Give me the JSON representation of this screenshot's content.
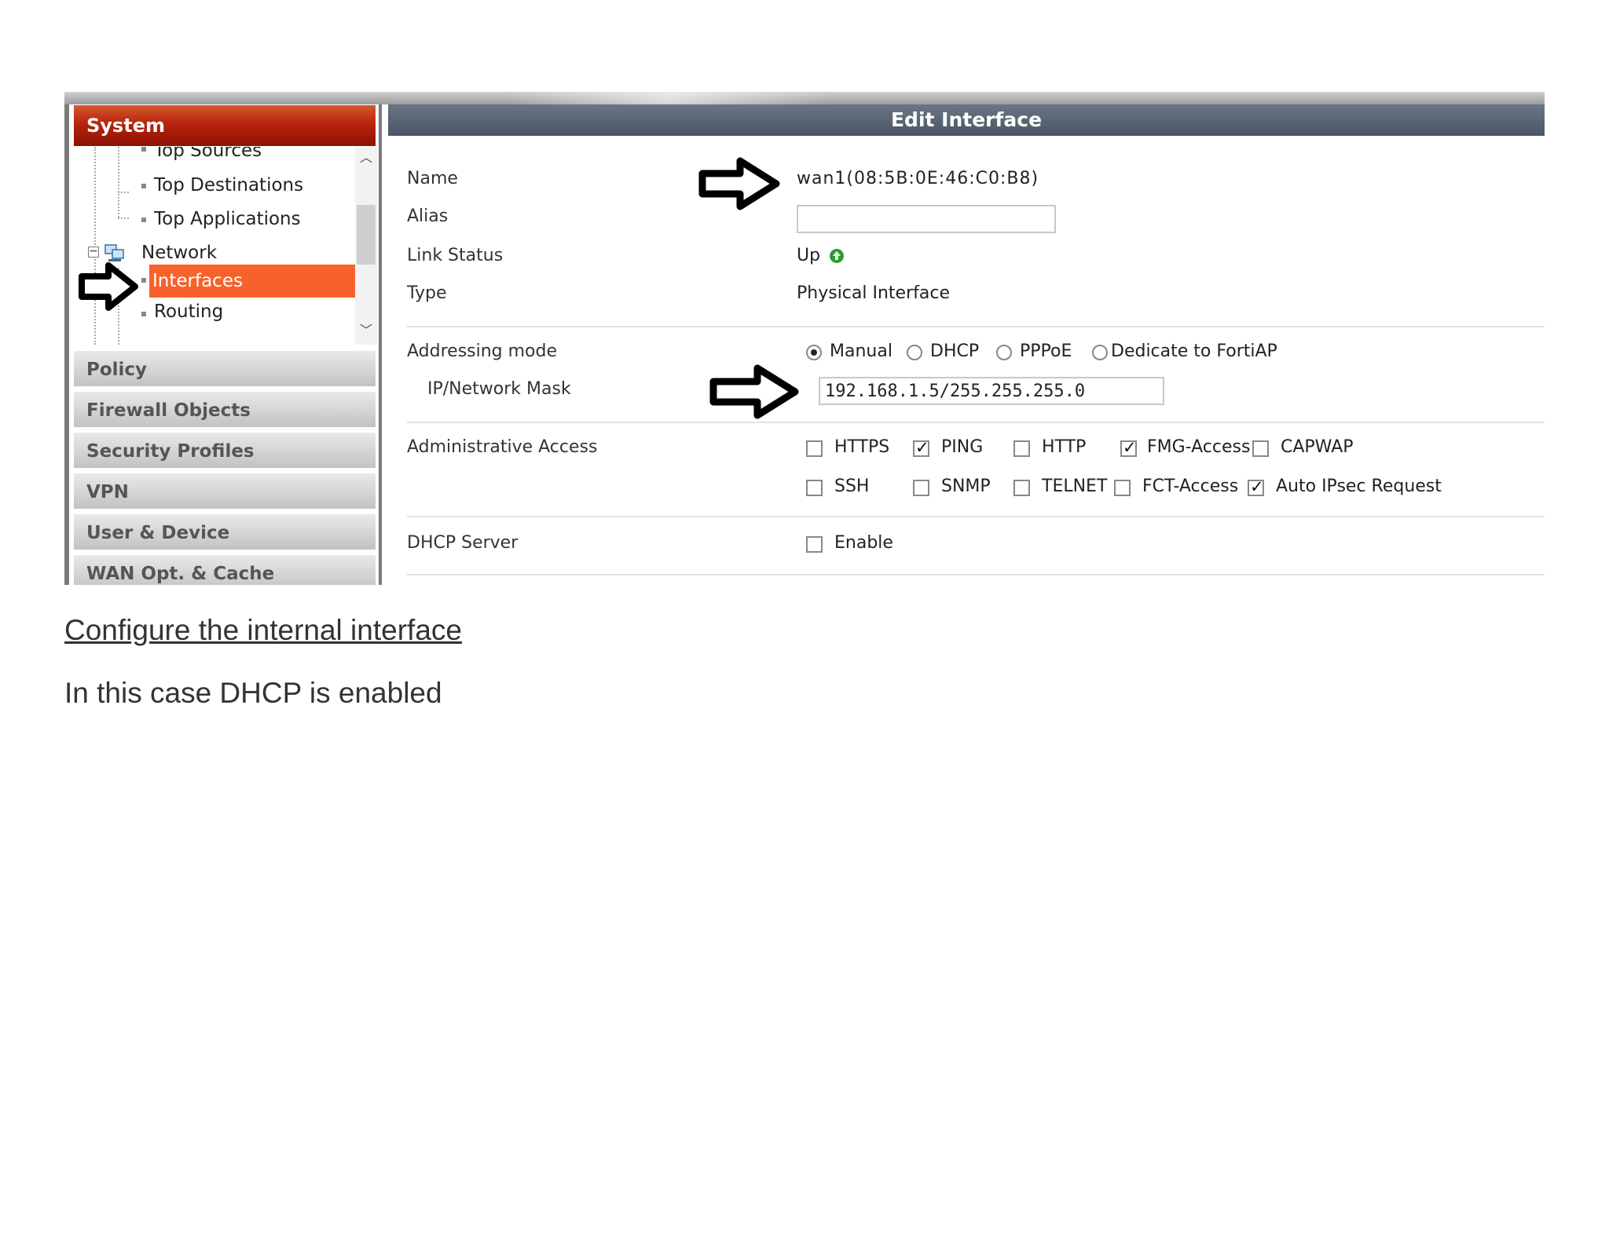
{
  "sidebar": {
    "header": "System",
    "tree": {
      "top_sources": "Top Sources",
      "top_destinations": "Top Destinations",
      "top_applications": "Top Applications",
      "network": "Network",
      "interfaces": "Interfaces",
      "routing": "Routing"
    },
    "sections": [
      "Policy",
      "Firewall Objects",
      "Security Profiles",
      "VPN",
      "User & Device",
      "WAN Opt. & Cache"
    ]
  },
  "panel": {
    "title": "Edit Interface",
    "name_label": "Name",
    "name_value": "wan1(08:5B:0E:46:C0:B8)",
    "alias_label": "Alias",
    "alias_value": "",
    "link_status_label": "Link Status",
    "link_status_value": "Up",
    "type_label": "Type",
    "type_value": "Physical Interface",
    "addressing_label": "Addressing mode",
    "addressing_options": [
      {
        "label": "Manual",
        "selected": true
      },
      {
        "label": "DHCP",
        "selected": false
      },
      {
        "label": "PPPoE",
        "selected": false
      },
      {
        "label": "Dedicate to FortiAP",
        "selected": false
      }
    ],
    "ip_label": "IP/Network Mask",
    "ip_value": "192.168.1.5/255.255.255.0",
    "admin_label": "Administrative Access",
    "admin_options": [
      {
        "label": "HTTPS",
        "checked": false
      },
      {
        "label": "PING",
        "checked": true
      },
      {
        "label": "HTTP",
        "checked": false
      },
      {
        "label": "FMG-Access",
        "checked": true
      },
      {
        "label": "CAPWAP",
        "checked": false
      },
      {
        "label": "SSH",
        "checked": false
      },
      {
        "label": "SNMP",
        "checked": false
      },
      {
        "label": "TELNET",
        "checked": false
      },
      {
        "label": "FCT-Access",
        "checked": false
      },
      {
        "label": "Auto IPsec Request",
        "checked": true
      }
    ],
    "dhcp_label": "DHCP Server",
    "dhcp_option": {
      "label": "Enable",
      "checked": false
    }
  },
  "caption": "Configure the internal interface",
  "note": "In this case DHCP is enabled",
  "colors": {
    "system_header": "#b8240c",
    "selected_item": "#f7622b",
    "panel_header": "#4a5666",
    "link_up": "#2e9e2e"
  }
}
